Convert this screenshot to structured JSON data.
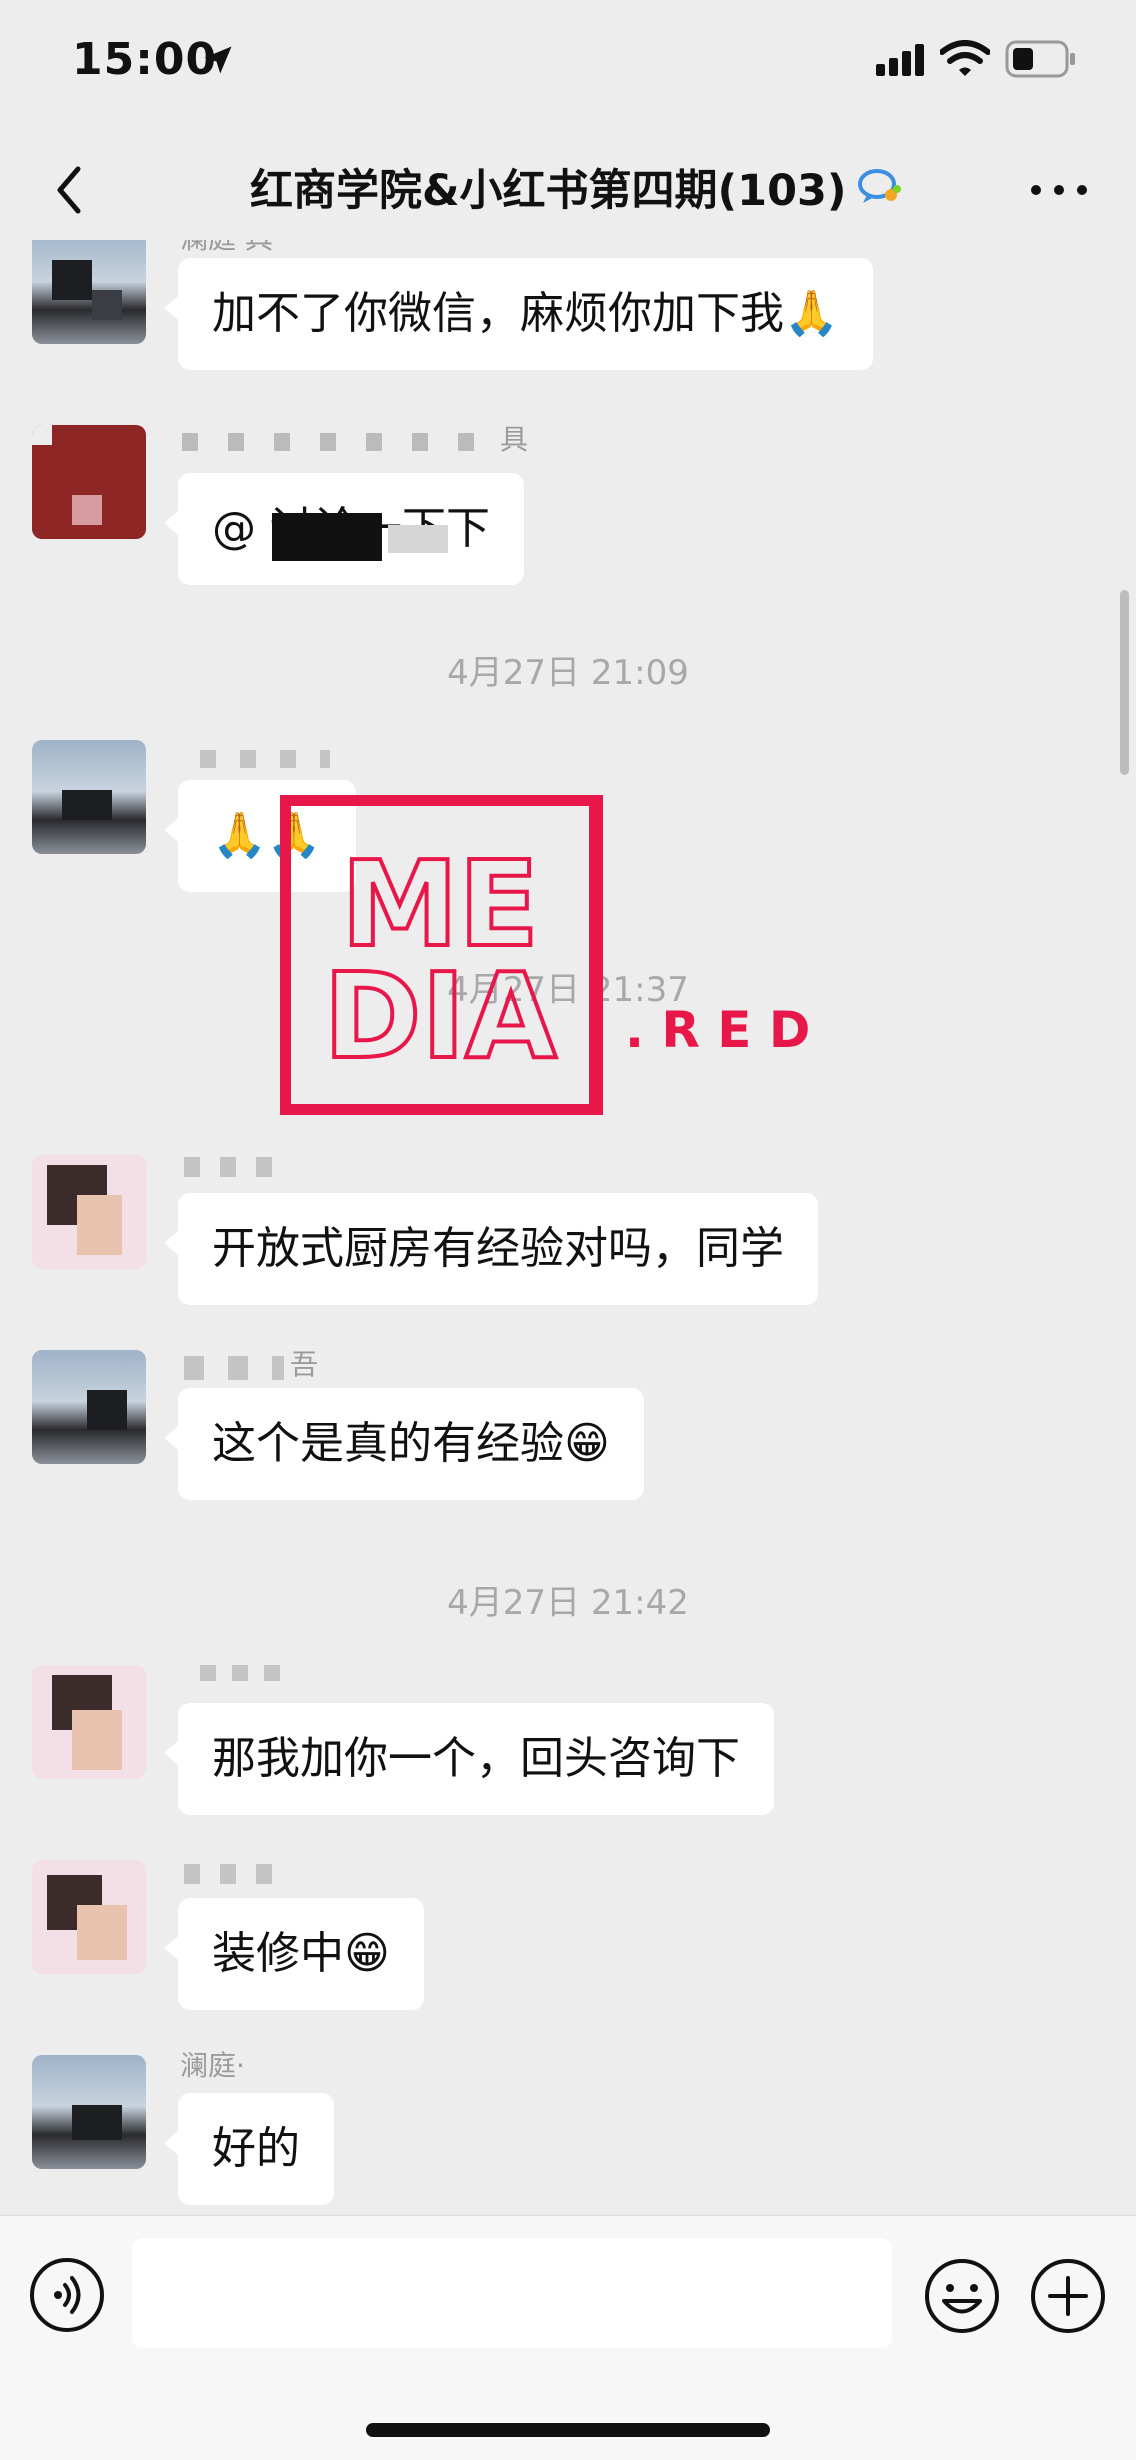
{
  "status_bar": {
    "time": "15:00"
  },
  "header": {
    "title": "红商学院&小红书第四期(103)"
  },
  "messages": [
    {
      "sender": "澜庭·具",
      "text": "加不了你微信，麻烦你加下我🙏"
    },
    {
      "sender": "具",
      "text": "@ 讨论一下下"
    },
    {
      "timestamp": "4月27日 21:09"
    },
    {
      "sender": "",
      "text": "🙏🙏"
    },
    {
      "timestamp": "4月27日 21:37"
    },
    {
      "sender": "",
      "text": "开放式厨房有经验对吗，同学"
    },
    {
      "sender": "吾",
      "text": "这个是真的有经验😁"
    },
    {
      "timestamp": "4月27日 21:42"
    },
    {
      "sender": "",
      "text": "那我加你一个，回头咨询下"
    },
    {
      "sender": "",
      "text": "装修中😁"
    },
    {
      "sender": "澜庭·",
      "text": "好的"
    }
  ],
  "watermark": {
    "line1": "ME",
    "line2": "DIA",
    "suffix": ". R E D"
  },
  "input": {
    "placeholder": ""
  },
  "colors": {
    "background": "#ededed",
    "bubble": "#ffffff",
    "accent": "#e8174a"
  },
  "icons": [
    "location-arrow-icon",
    "signal-icon",
    "wifi-icon",
    "battery-icon",
    "back-icon",
    "group-chat-icon",
    "more-icon",
    "voice-icon",
    "emoji-icon",
    "add-icon"
  ]
}
